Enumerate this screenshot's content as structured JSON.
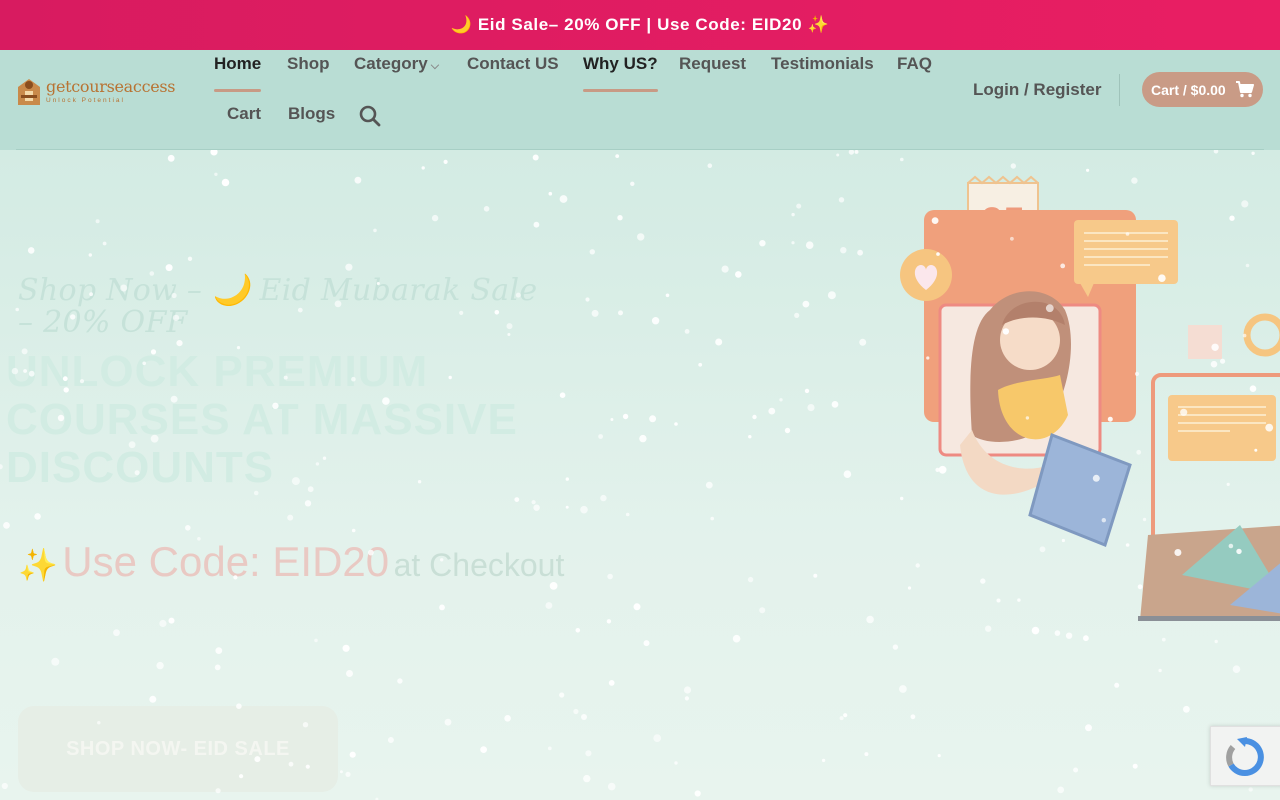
{
  "promo": {
    "text": "🌙 Eid Sale– 20% OFF | Use Code: EID20 ✨"
  },
  "logo": {
    "name": "getcourseaccess",
    "tagline": "Unlock Potential"
  },
  "nav": {
    "items": [
      {
        "label": "Home"
      },
      {
        "label": "Shop"
      },
      {
        "label": "Category"
      },
      {
        "label": "Contact US"
      },
      {
        "label": "Why US?"
      },
      {
        "label": "Request"
      },
      {
        "label": "Testimonials"
      },
      {
        "label": "FAQ"
      },
      {
        "label": "Cart"
      },
      {
        "label": "Blogs"
      }
    ],
    "active": [
      "Home",
      "Why US?"
    ]
  },
  "account": {
    "login_label": "Login / Register"
  },
  "cart": {
    "label": "Cart / $0.00"
  },
  "hero": {
    "script_line": "Shop Now – 🌙 Eid Mubarak Sale – 20% OFF",
    "title": "UNLOCK PREMIUM COURSES AT MASSIVE DISCOUNTS",
    "code_sparkle": "✨",
    "code_main": "Use Code: EID20",
    "code_suffix": "at Checkout",
    "cta_label": "SHOP NOW- EID SALE",
    "calendar_day": "25"
  },
  "colors": {
    "promo": "#e91e63",
    "header": "#b9ddd4",
    "cart_button": "#c99b86",
    "accent_underline": "#c89a85"
  },
  "icons": {
    "search": "search-icon",
    "cart": "cart-icon",
    "category_chevron": "chevron-down-icon"
  }
}
